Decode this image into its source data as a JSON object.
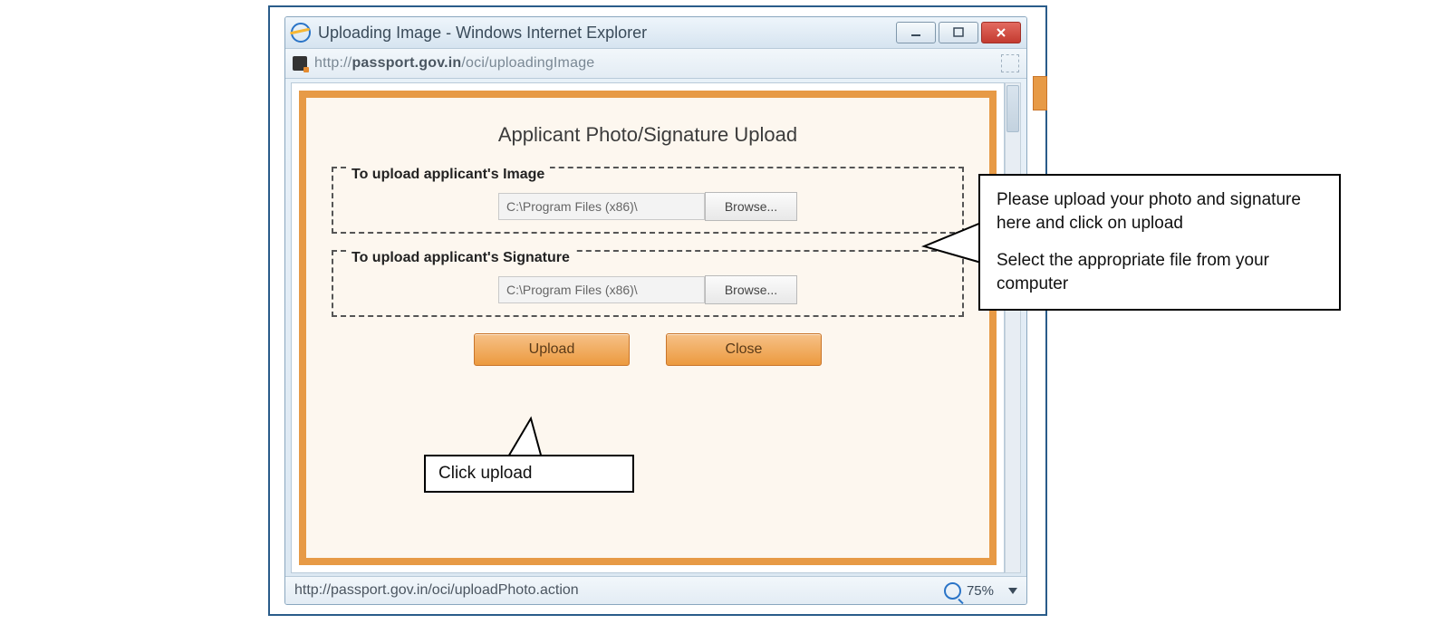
{
  "window": {
    "title": "Uploading Image - Windows Internet Explorer",
    "url_display_prefix": "http://",
    "url_display_bold": "passport.gov.in",
    "url_display_suffix": "/oci/uploadingImage"
  },
  "page": {
    "heading": "Applicant Photo/Signature Upload",
    "image_section": {
      "legend": "To upload applicant's Image",
      "file_path": "C:\\Program Files (x86)\\",
      "browse_label": "Browse..."
    },
    "signature_section": {
      "legend": "To upload applicant's Signature",
      "file_path": "C:\\Program Files (x86)\\",
      "browse_label": "Browse..."
    },
    "buttons": {
      "upload": "Upload",
      "close": "Close"
    }
  },
  "statusbar": {
    "text": "http://passport.gov.in/oci/uploadPhoto.action",
    "zoom": "75%"
  },
  "callouts": {
    "main_p1": "Please upload your photo and signature here and click on upload",
    "main_p2": "Select the appropriate file from your computer",
    "upload_hint": "Click upload"
  }
}
